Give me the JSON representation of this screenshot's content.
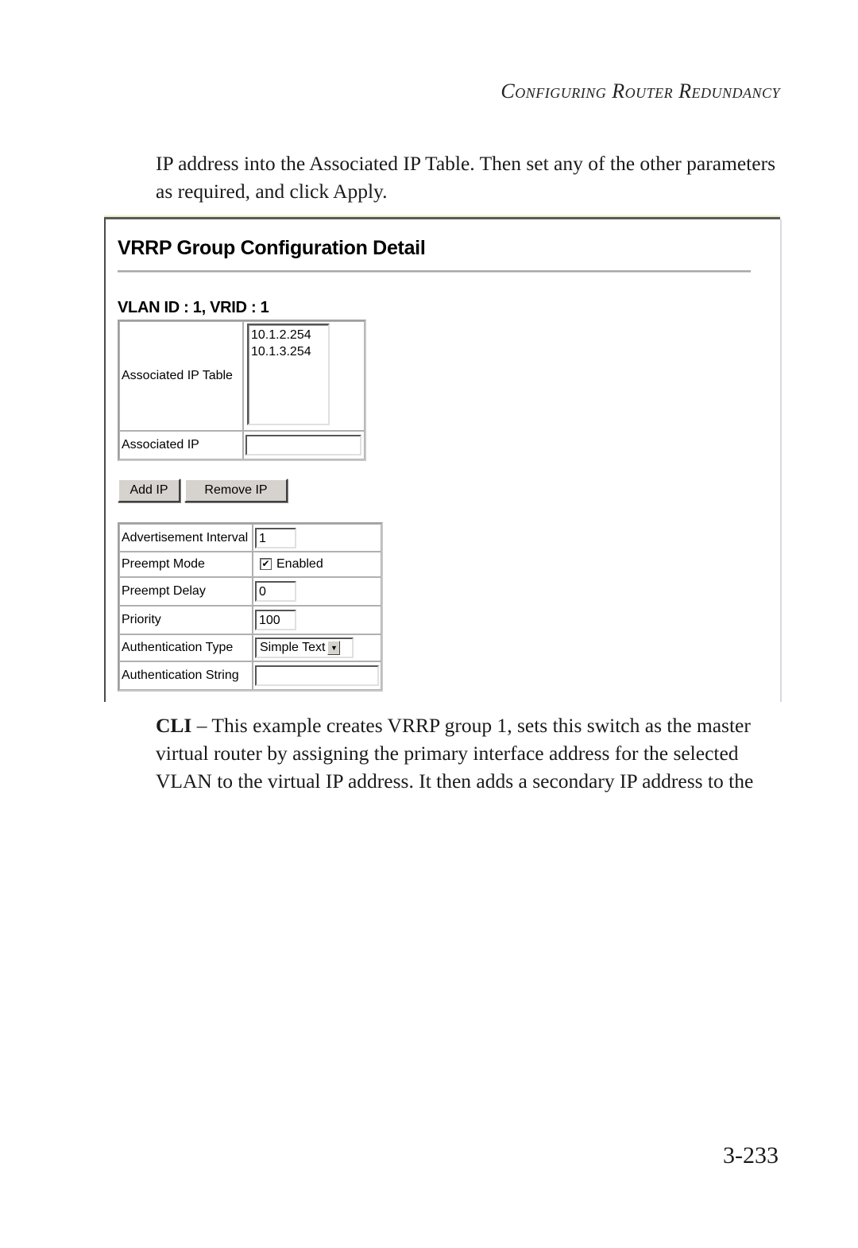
{
  "running_head": "Configuring Router Redundancy",
  "intro_paragraph": "IP address into the Associated IP Table. Then set any of the other parameters as required, and click Apply.",
  "screenshot": {
    "title": "VRRP Group Configuration Detail",
    "subtitle": "VLAN ID : 1, VRID : 1",
    "associated_ip_table": {
      "label": "Associated IP Table",
      "entries": [
        "10.1.2.254",
        "10.1.3.254"
      ]
    },
    "associated_ip": {
      "label": "Associated IP",
      "value": ""
    },
    "buttons": {
      "add_ip": "Add IP",
      "remove_ip": "Remove IP"
    },
    "params": {
      "advertisement_interval": {
        "label": "Advertisement Interval",
        "value": "1"
      },
      "preempt_mode": {
        "label": "Preempt Mode",
        "checked": true,
        "checkbox_label": "Enabled",
        "check_glyph": "✔"
      },
      "preempt_delay": {
        "label": "Preempt Delay",
        "value": "0"
      },
      "priority": {
        "label": "Priority",
        "value": "100"
      },
      "authentication_type": {
        "label": "Authentication Type",
        "selected": "Simple Text",
        "arrow_glyph": "▼"
      },
      "authentication_string": {
        "label": "Authentication String",
        "value": ""
      }
    }
  },
  "cli_paragraph": {
    "lead": "CLI",
    "text": " – This example creates VRRP group 1, sets this switch as the master virtual router by assigning the primary interface address for the selected VLAN to the virtual IP address. It then adds a secondary IP address to the"
  },
  "page_number": "3-233"
}
